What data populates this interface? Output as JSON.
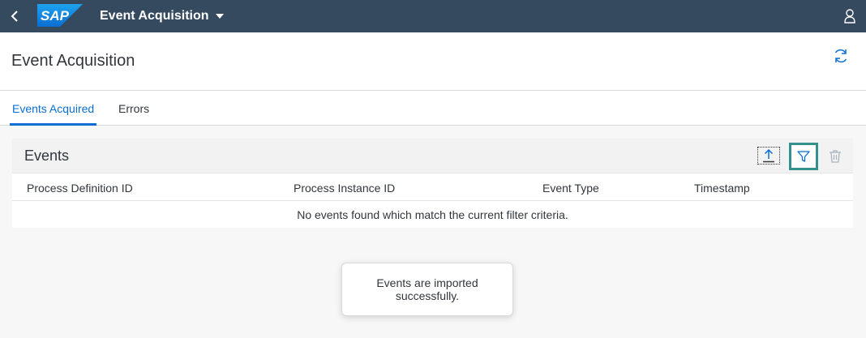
{
  "shellbar": {
    "logo_text": "SAP",
    "app_title": "Event Acquisition",
    "colors": {
      "background": "#354a5f",
      "logo": "#0a6ed1"
    }
  },
  "page": {
    "title": "Event Acquisition"
  },
  "tabs": [
    {
      "label": "Events Acquired",
      "selected": true
    },
    {
      "label": "Errors",
      "selected": false
    }
  ],
  "events": {
    "title": "Events",
    "columns": [
      "Process Definition ID",
      "Process Instance ID",
      "Event Type",
      "Timestamp"
    ],
    "no_data_text": "No events found which match the current filter criteria."
  },
  "toast": {
    "message": "Events are imported successfully."
  },
  "icons": [
    "back-icon",
    "dropdown-icon",
    "user-icon",
    "refresh-icon",
    "upload-icon",
    "filter-icon",
    "delete-icon"
  ],
  "accent_color": "#0a6ed1"
}
